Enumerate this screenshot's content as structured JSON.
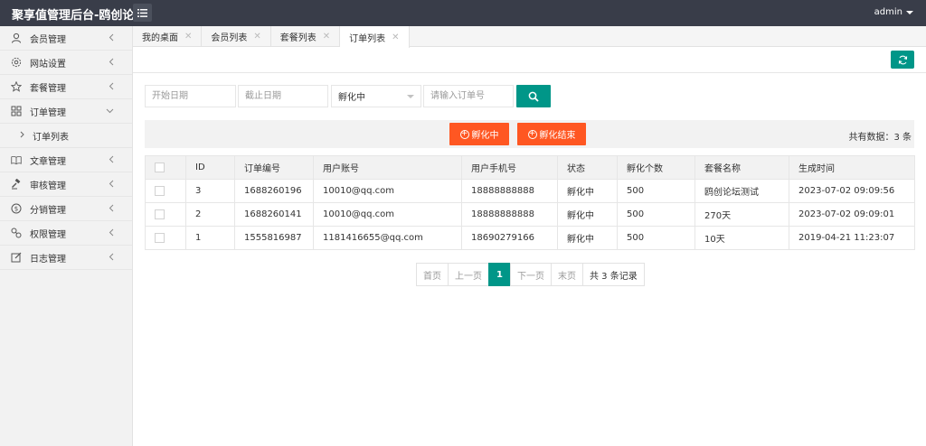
{
  "header": {
    "brand": "聚享值管理后台-鸥创论",
    "user": "admin"
  },
  "sidebar": {
    "items": [
      {
        "label": "会员管理",
        "icon": "user-icon",
        "arrow": "chevron-left"
      },
      {
        "label": "网站设置",
        "icon": "gear-icon",
        "arrow": "chevron-left"
      },
      {
        "label": "套餐管理",
        "icon": "star-icon",
        "arrow": "chevron-left"
      },
      {
        "label": "订单管理",
        "icon": "grid-icon",
        "arrow": "chevron-down"
      },
      {
        "label": "文章管理",
        "icon": "book-icon",
        "arrow": "chevron-left"
      },
      {
        "label": "审核管理",
        "icon": "gavel-icon",
        "arrow": "chevron-left"
      },
      {
        "label": "分销管理",
        "icon": "dollar-icon",
        "arrow": "chevron-left"
      },
      {
        "label": "权限管理",
        "icon": "link-icon",
        "arrow": "chevron-left"
      },
      {
        "label": "日志管理",
        "icon": "edit-icon",
        "arrow": "chevron-left"
      }
    ],
    "sub_item": "订单列表"
  },
  "tabs": [
    {
      "label": "我的桌面"
    },
    {
      "label": "会员列表"
    },
    {
      "label": "套餐列表"
    },
    {
      "label": "订单列表",
      "active": true
    }
  ],
  "search": {
    "start_placeholder": "开始日期",
    "end_placeholder": "截止日期",
    "status_selected": "孵化中",
    "order_placeholder": "请输入订单号"
  },
  "toolbar": {
    "btn_incubating": "孵化中",
    "btn_finished": "孵化结束",
    "total": "共有数据：3 条"
  },
  "table": {
    "columns": [
      "ID",
      "订单编号",
      "用户账号",
      "用户手机号",
      "状态",
      "孵化个数",
      "套餐名称",
      "生成时间"
    ],
    "rows": [
      [
        "3",
        "1688260196",
        "10010@qq.com",
        "18888888888",
        "孵化中",
        "500",
        "鸥创论坛测试",
        "2023-07-02 09:09:56"
      ],
      [
        "2",
        "1688260141",
        "10010@qq.com",
        "18888888888",
        "孵化中",
        "500",
        "270天",
        "2023-07-02 09:09:01"
      ],
      [
        "1",
        "1555816987",
        "1181416655@qq.com",
        "18690279166",
        "孵化中",
        "500",
        "10天",
        "2019-04-21 11:23:07"
      ]
    ]
  },
  "pager": {
    "first": "首页",
    "prev": "上一页",
    "current": "1",
    "next": "下一页",
    "last": "末页",
    "info": "共 3 条记录"
  },
  "colors": {
    "header_bg": "#393d49",
    "accent": "#009688",
    "warn": "#ff5722"
  }
}
